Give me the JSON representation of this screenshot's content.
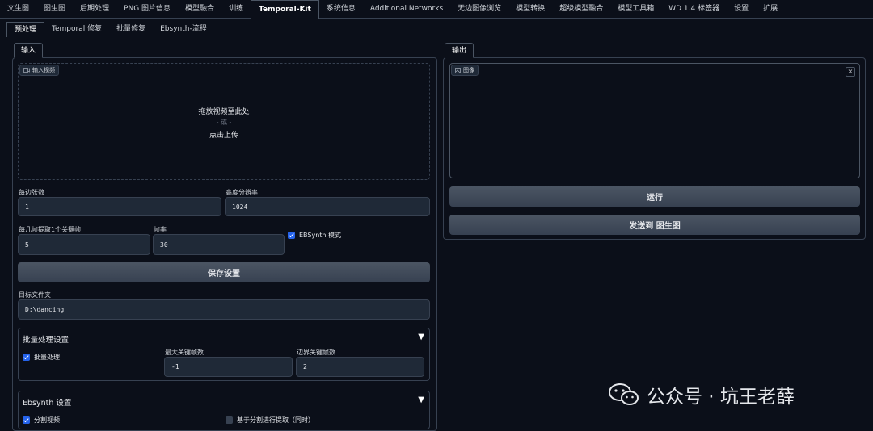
{
  "top_tabs": [
    "文生图",
    "图生图",
    "后期处理",
    "PNG 图片信息",
    "模型融合",
    "训练",
    "Temporal-Kit",
    "系统信息",
    "Additional Networks",
    "无边图像浏览",
    "模型转换",
    "超级模型融合",
    "模型工具箱",
    "WD 1.4 标签器",
    "设置",
    "扩展"
  ],
  "active_top_tab": "Temporal-Kit",
  "sub_tabs": [
    "预处理",
    "Temporal 修复",
    "批量修复",
    "Ebsynth-流程"
  ],
  "input_panel": {
    "tab": "输入",
    "video_label": "输入视频",
    "drop_text": "拖放视频至此处",
    "or_text": "- 或 -",
    "click_text": "点击上传",
    "sides_label": "每边张数",
    "sides_value": "1",
    "height_label": "高度分辨率",
    "height_value": "1024",
    "keyframe_label": "每几帧提取1个关键帧",
    "keyframe_value": "5",
    "fps_label": "帧率",
    "fps_value": "30",
    "ebsynth_mode_label": "EBSynth 模式",
    "save_button": "保存设置",
    "target_folder_label": "目标文件夹",
    "target_folder_value": "D:\\dancing",
    "batch_section": {
      "title": "批量处理设置",
      "batch_label": "批量处理",
      "max_keyframes_label": "最大关键帧数",
      "max_keyframes_value": "-1",
      "border_keyframes_label": "边界关键帧数",
      "border_keyframes_value": "2"
    },
    "ebsynth_section": {
      "title": "Ebsynth 设置",
      "split_video_label": "分割视频",
      "split_extract_label": "基于分割进行提取（同时）"
    }
  },
  "output_panel": {
    "tab": "输出",
    "image_label": "图像",
    "close": "×",
    "run_button": "运行",
    "send_button": "发送到 图生图"
  },
  "watermark": "公众号 · 坑王老薛"
}
